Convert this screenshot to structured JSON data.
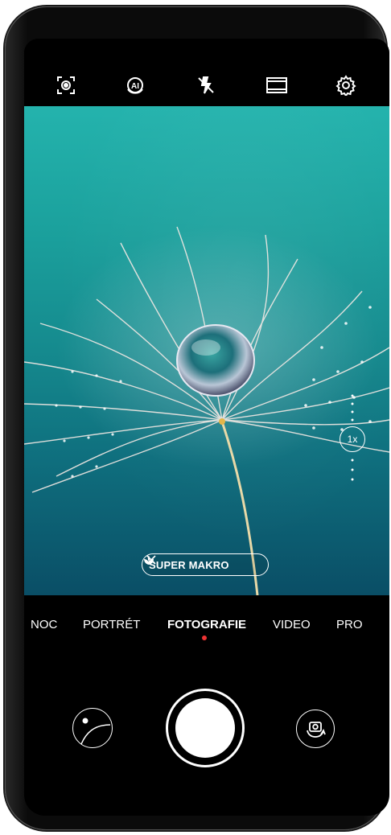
{
  "top_bar": {
    "icons": [
      "portrait-focus-icon",
      "ai-icon",
      "flash-off-icon",
      "aspect-ratio-icon",
      "settings-gear-icon"
    ]
  },
  "viewfinder": {
    "subject": "dandelion seed with water droplet",
    "zoom_label": "1x",
    "macro_chip": {
      "label": "SUPER MAKRO",
      "icon": "flower-icon",
      "close_icon": "close-icon"
    }
  },
  "modes": {
    "items": [
      "NOC",
      "PORTRÉT",
      "FOTOGRAFIE",
      "VIDEO",
      "PRO"
    ],
    "active": "FOTOGRAFIE"
  },
  "colors": {
    "accent_dot": "#e33333",
    "background": "#000000",
    "foreground": "#ffffff"
  }
}
